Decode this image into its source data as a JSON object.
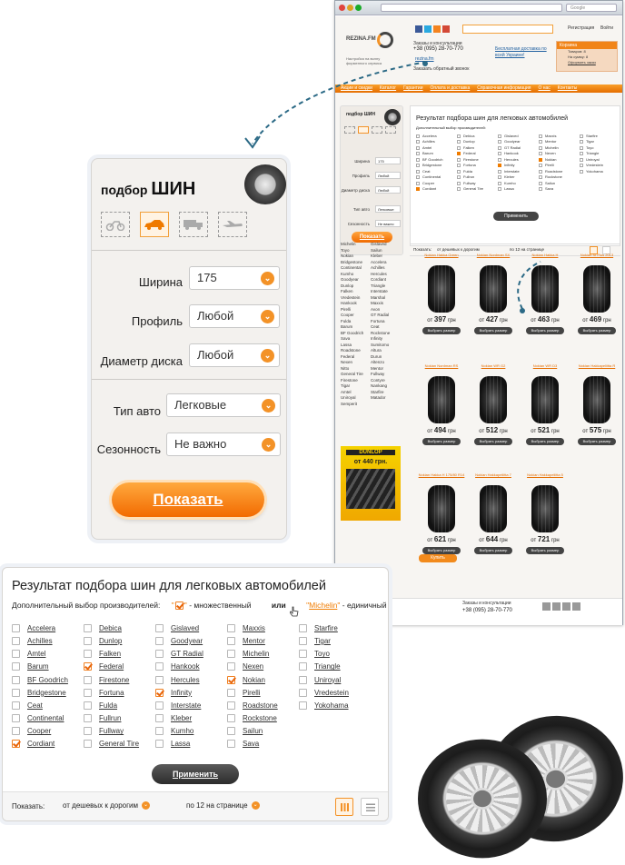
{
  "browser": {
    "search_placeholder": "Google"
  },
  "site": {
    "logo": "REZINA.FM",
    "tagline": "Настройся на волну\nфирменного сервиса",
    "orders_label": "Заказы и консультации",
    "phone": "+38 (095) 28-70-770",
    "skype": "rezina.fm",
    "callback": "Заказать обратный звонок",
    "delivery": "Бесплатная доставка по всей Украине!",
    "register": "Регистрация",
    "login": "Войти",
    "cart_title": "Корзина",
    "cart_items": "Товаров: 8",
    "cart_sum": "На сумму: 8",
    "cart_checkout": "Оформить заказ",
    "nav": [
      "Акции и скидки",
      "Каталог",
      "Гарантии",
      "Оплата и доставка",
      "Справочная информация",
      "О нас",
      "Контакты"
    ],
    "sort_label": "Показать:",
    "sort_value": "от дешевых к дорогим",
    "per_page": "по 12 на странице",
    "mini_brands": [
      "Michelin",
      "Gislaved",
      "Toyo",
      "Sailun",
      "Nokian",
      "Kleber",
      "Bridgestone",
      "Accelera",
      "Continental",
      "Achilles",
      "Kumho",
      "Hercules",
      "Goodyear",
      "Cordiant",
      "Dunlop",
      "Triangle",
      "Falken",
      "Interstate",
      "Vredestein",
      "Marshal",
      "Hankook",
      "Maxxis",
      "Pirelli",
      "Avon",
      "Cooper",
      "GT Radial",
      "Fulda",
      "Fortuna",
      "Barum",
      "Ceat",
      "BF Goodrich",
      "Rockstone",
      "Sava",
      "Infinity",
      "Lassa",
      "Sumitomo",
      "Roadstone",
      "Altura",
      "Federal",
      "Durun",
      "Nexen",
      "Altenzo",
      "Nitto",
      "Mentor",
      "General Tire",
      "Fullway",
      "Firestone",
      "Contyre",
      "Tigar",
      "Nankang",
      "Amtel",
      "Starfire",
      "Uniroyal",
      "Matador",
      "Semperit"
    ],
    "ad_text": "от 440 грн.",
    "products": [
      {
        "name": "Nokian Hakka Green",
        "price": "397"
      },
      {
        "name": "Nokian Nordman SX",
        "price": "427"
      },
      {
        "name": "Nokian Hakka H",
        "price": "463"
      },
      {
        "name": "Nokian SI Plus 2013",
        "price": "469"
      },
      {
        "name": "Nokian Nordman RS",
        "price": "494"
      },
      {
        "name": "Nokian WR G2",
        "price": "512"
      },
      {
        "name": "Nokian WR D3",
        "price": "521"
      },
      {
        "name": "Nokian Hakkapeliitta R",
        "price": "575"
      },
      {
        "name": "Nokian Hakka H 175/80 R14",
        "price": "621"
      },
      {
        "name": "Nokian Hakkapeliitta 7",
        "price": "644"
      },
      {
        "name": "Nokian Hakkapeliitta 5",
        "price": "721"
      }
    ],
    "price_prefix": "от",
    "currency": "грн",
    "choose_label": "Выбрать размер",
    "buy_label": "Купить",
    "footer_phone": "+38 (095) 28-70-770"
  },
  "picker": {
    "title_small": "подбор",
    "title_big": "ШИН",
    "vehicle_types": [
      "moto-icon",
      "car-icon",
      "truck-icon",
      "plane-icon"
    ],
    "fields": [
      {
        "label": "Ширина",
        "value": "175"
      },
      {
        "label": "Профиль",
        "value": "Любой"
      },
      {
        "label": "Диаметр диска",
        "value": "Любой"
      }
    ],
    "fields2": [
      {
        "label": "Тип авто",
        "value": "Легковые"
      },
      {
        "label": "Сезонность",
        "value": "Не важно"
      }
    ],
    "submit": "Показать"
  },
  "results": {
    "title": "Результат подбора шин для легковых автомобилей",
    "subtitle": "Дополнительный выбор производителей:",
    "multi_label": "- множественный",
    "or": "или",
    "single_example": "Michelin",
    "single_label": "- единичный",
    "brands": [
      {
        "name": "Accelera",
        "checked": false
      },
      {
        "name": "Debica",
        "checked": false
      },
      {
        "name": "Gislaved",
        "checked": false
      },
      {
        "name": "Maxxis",
        "checked": false
      },
      {
        "name": "Starfire",
        "checked": false
      },
      {
        "name": "Achilles",
        "checked": false
      },
      {
        "name": "Dunlop",
        "checked": false
      },
      {
        "name": "Goodyear",
        "checked": false
      },
      {
        "name": "Mentor",
        "checked": false
      },
      {
        "name": "Tigar",
        "checked": false
      },
      {
        "name": "Amtel",
        "checked": false
      },
      {
        "name": "Falken",
        "checked": false
      },
      {
        "name": "GT Radial",
        "checked": false
      },
      {
        "name": "Michelin",
        "checked": false
      },
      {
        "name": "Toyo",
        "checked": false
      },
      {
        "name": "Barum",
        "checked": false
      },
      {
        "name": "Federal",
        "checked": true
      },
      {
        "name": "Hankook",
        "checked": false
      },
      {
        "name": "Nexen",
        "checked": false
      },
      {
        "name": "Triangle",
        "checked": false
      },
      {
        "name": "BF Goodrich",
        "checked": false
      },
      {
        "name": "Firestone",
        "checked": false
      },
      {
        "name": "Hercules",
        "checked": false
      },
      {
        "name": "Nokian",
        "checked": true
      },
      {
        "name": "Uniroyal",
        "checked": false
      },
      {
        "name": "Bridgestone",
        "checked": false
      },
      {
        "name": "Fortuna",
        "checked": false
      },
      {
        "name": "Infinity",
        "checked": true
      },
      {
        "name": "Pirelli",
        "checked": false
      },
      {
        "name": "Vredestein",
        "checked": false
      },
      {
        "name": "Ceat",
        "checked": false
      },
      {
        "name": "Fulda",
        "checked": false
      },
      {
        "name": "Interstate",
        "checked": false
      },
      {
        "name": "Roadstone",
        "checked": false
      },
      {
        "name": "Yokohama",
        "checked": false
      },
      {
        "name": "Continental",
        "checked": false
      },
      {
        "name": "Fullrun",
        "checked": false
      },
      {
        "name": "Kleber",
        "checked": false
      },
      {
        "name": "Rockstone",
        "checked": false
      },
      null,
      {
        "name": "Cooper",
        "checked": false
      },
      {
        "name": "Fullway",
        "checked": false
      },
      {
        "name": "Kumho",
        "checked": false
      },
      {
        "name": "Sailun",
        "checked": false
      },
      null,
      {
        "name": "Cordiant",
        "checked": true
      },
      {
        "name": "General Tire",
        "checked": false
      },
      {
        "name": "Lassa",
        "checked": false
      },
      {
        "name": "Sava",
        "checked": false
      },
      null
    ],
    "apply": "Применить",
    "show_label": "Показать:",
    "sort_value": "от дешевых к дорогим",
    "per_page": "по 12 на странице"
  },
  "colors": {
    "accent": "#f39227",
    "accent_dark": "#e56d00",
    "dark_button": "#333333"
  }
}
